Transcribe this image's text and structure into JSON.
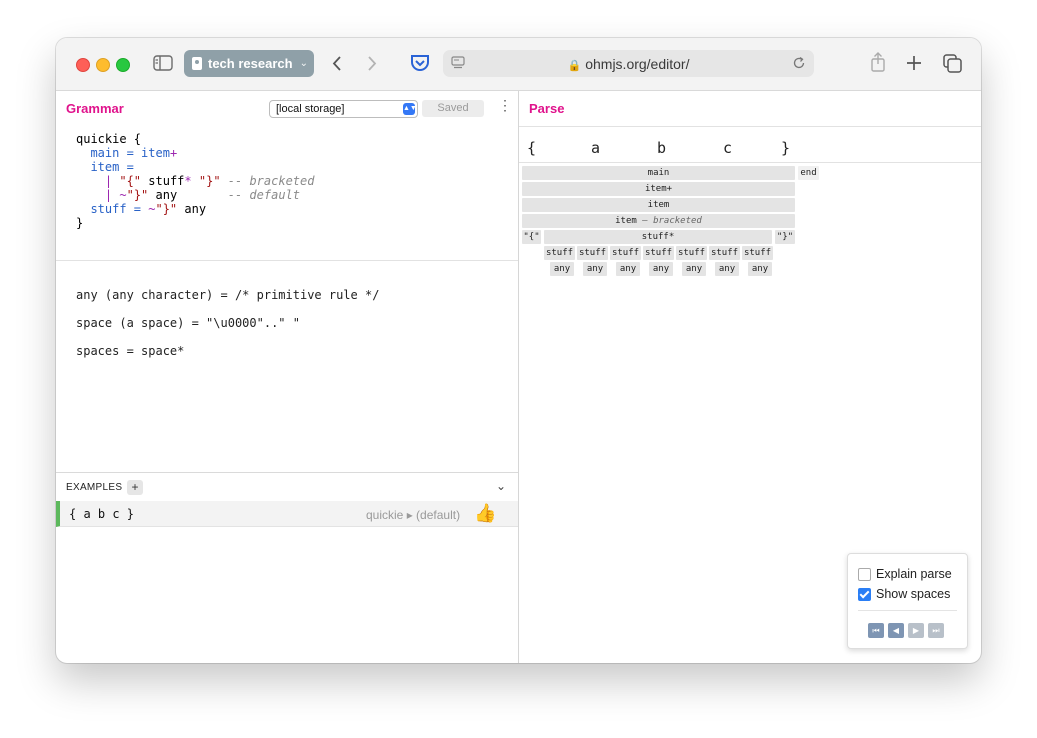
{
  "browser": {
    "tab_group": "tech research",
    "url": "ohmjs.org/editor/",
    "icons": [
      "sidebar-icon",
      "back-icon",
      "forward-icon",
      "pocket-icon",
      "reader-icon",
      "lock-icon",
      "reload-icon",
      "share-icon",
      "new-tab-icon",
      "tab-overview-icon"
    ]
  },
  "grammar": {
    "title": "Grammar",
    "storage": "[local storage]",
    "saved": "Saved",
    "code": {
      "l1a": "quickie {",
      "l2a": "main = item",
      "l2b": "+",
      "l3a": "item =",
      "l4a": "| ",
      "l4b": "\"{\"",
      "l4c": " stuff",
      "l4d": "*",
      "l4e": " \"}\"",
      "l4f": " -- bracketed",
      "l5a": "| ",
      "l5b": "~",
      "l5c": "\"}\"",
      "l5d": " any",
      "l5e": "       -- default",
      "l6a": "stuff = ",
      "l6b": "~",
      "l6c": "\"}\"",
      "l6d": " any",
      "l7a": "}"
    },
    "builtins": [
      "any (any character) = /* primitive rule */",
      "space (a space) = \"\\u0000\"..\" \"",
      "spaces = space*"
    ]
  },
  "examples": {
    "title": "EXAMPLES",
    "add": "+",
    "collapse": "⌄",
    "items": [
      {
        "input": "{ a b c }",
        "start_rule": "quickie ▸ (default)",
        "status": "👍"
      }
    ]
  },
  "parse": {
    "title": "Parse",
    "chars": [
      "{",
      "a",
      "b",
      "c",
      "}"
    ],
    "nodes": {
      "main": "main",
      "end": "end",
      "item_plus": "item+",
      "item": "item",
      "item_bracketed": "item",
      "bracketed_case": "— bracketed",
      "lbrace": "\"{\"",
      "stuff_star": "stuff*",
      "rbrace": "\"}\"",
      "stuff": "stuff",
      "any": "any"
    }
  },
  "options": {
    "explain_parse": {
      "label": "Explain parse",
      "checked": false
    },
    "show_spaces": {
      "label": "Show spaces",
      "checked": true
    },
    "step_buttons": [
      "⏮",
      "◀",
      "▶",
      "⏭"
    ]
  },
  "colors": {
    "accent": "#e0138c",
    "keyword": "#2962c7",
    "operator": "#9c27b0",
    "string": "#a31515",
    "success": "#5cb85c"
  }
}
